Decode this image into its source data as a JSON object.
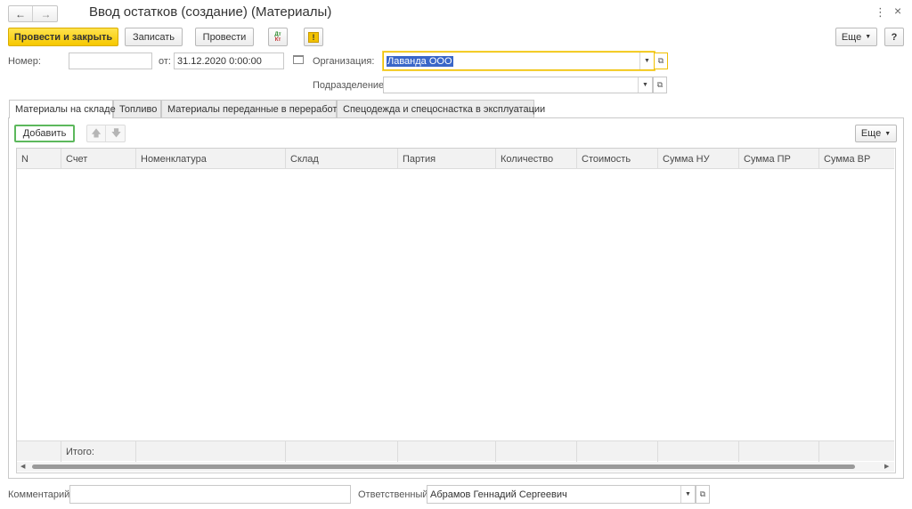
{
  "window": {
    "title": "Ввод остатков (создание) (Материалы)"
  },
  "toolbar": {
    "post_close_label": "Провести и закрыть",
    "save_label": "Записать",
    "post_label": "Провести",
    "dtkt_label": "Дт Кт",
    "more_label": "Еще",
    "help_label": "?"
  },
  "form": {
    "number_label": "Номер:",
    "number_value": "",
    "date_label": "от:",
    "date_value": "31.12.2020  0:00:00",
    "org_label": "Организация:",
    "org_value": "Лаванда ООО",
    "dept_label": "Подразделение:",
    "dept_value": ""
  },
  "tabs": [
    {
      "label": "Материалы на складе"
    },
    {
      "label": "Топливо"
    },
    {
      "label": "Материалы переданные в переработку"
    },
    {
      "label": "Спецодежда и спецоснастка в эксплуатации"
    }
  ],
  "table_toolbar": {
    "add_label": "Добавить",
    "more_label": "Еще"
  },
  "table": {
    "columns": [
      "N",
      "Счет",
      "Номенклатура",
      "Склад",
      "Партия",
      "Количество",
      "Стоимость",
      "Сумма НУ",
      "Сумма ПР",
      "Сумма ВР"
    ],
    "footer_total_label": "Итого:"
  },
  "footer": {
    "comment_label": "Комментарий:",
    "comment_value": "",
    "responsible_label": "Ответственный:",
    "responsible_value": "Абрамов Геннадий Сергеевич"
  },
  "colors": {
    "primary_button": "#f6c800",
    "active_field_border": "#f0c000",
    "selection": "#3a66c8",
    "add_button_border": "#5cb85c"
  }
}
